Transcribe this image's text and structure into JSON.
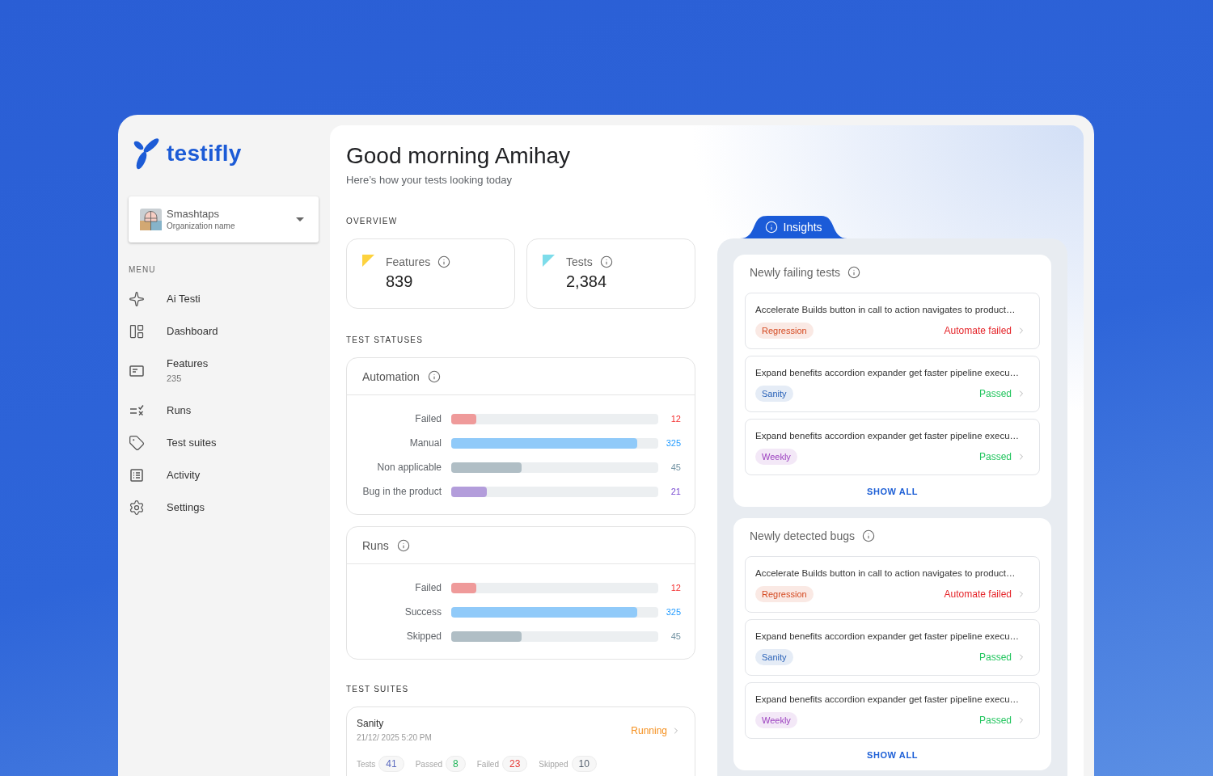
{
  "sidebar": {
    "brand": "testifly",
    "org": {
      "name": "Smashtaps",
      "subtitle": "Organization name"
    },
    "menu_heading": "MENU",
    "menu": [
      {
        "label": "Ai Testi"
      },
      {
        "label": "Dashboard"
      },
      {
        "label": "Features",
        "count": "235"
      },
      {
        "label": "Runs"
      },
      {
        "label": "Test suites"
      },
      {
        "label": "Activity"
      },
      {
        "label": "Settings"
      }
    ]
  },
  "header": {
    "title": "Good morning Amihay",
    "subtitle": "Here’s how your tests looking today"
  },
  "overview": {
    "heading": "OVERVIEW",
    "cards": [
      {
        "label": "Features",
        "value": "839",
        "color": "#fdd23e"
      },
      {
        "label": "Tests",
        "value": "2,384",
        "color": "#7ddcea"
      }
    ]
  },
  "test_statuses": {
    "heading": "TEST STATUSES",
    "panels": [
      {
        "title": "Automation",
        "rows": [
          {
            "label": "Failed",
            "value": "12",
            "level": 0.12,
            "color": "#ef9a9a"
          },
          {
            "label": "Manual",
            "value": "325",
            "level": 0.9,
            "color": "#90caf9"
          },
          {
            "label": "Non applicable",
            "value": "45",
            "level": 0.34,
            "color": "#b0bec5"
          },
          {
            "label": "Bug in the product",
            "value": "21",
            "level": 0.17,
            "color": "#b39ddb"
          }
        ]
      },
      {
        "title": "Runs",
        "rows": [
          {
            "label": "Failed",
            "value": "12",
            "level": 0.12,
            "color": "#ef9a9a"
          },
          {
            "label": "Success",
            "value": "325",
            "level": 0.9,
            "color": "#90caf9"
          },
          {
            "label": "Skipped",
            "value": "45",
            "level": 0.34,
            "color": "#b0bec5"
          }
        ]
      }
    ]
  },
  "test_suites": {
    "heading": "TEST SUITES",
    "items": [
      {
        "name": "Sanity",
        "date": "21/12/ 2025 5:20 PM",
        "status": {
          "label": "Running",
          "kind": "running"
        },
        "counts": [
          {
            "label": "Tests",
            "value": "41",
            "color": "#5c6bc0"
          },
          {
            "label": "Passed",
            "value": "8",
            "color": "#21b65a"
          },
          {
            "label": "Failed",
            "value": "23",
            "color": "#e53935"
          },
          {
            "label": "Skipped",
            "value": "10",
            "color": "#55606e"
          }
        ]
      }
    ]
  },
  "insights": {
    "tab": "Insights",
    "sections": [
      {
        "title": "Newly failing tests",
        "items": [
          {
            "text": "Accelerate Builds button in call to action navigates to product…",
            "tag": {
              "label": "Regression",
              "color": "#d4481f"
            },
            "status": {
              "label": "Automate failed",
              "kind": "failed"
            }
          },
          {
            "text": "Expand benefits accordion expander get faster pipeline execu…",
            "tag": {
              "label": "Sanity",
              "color": "#2a62b8"
            },
            "status": {
              "label": "Passed",
              "kind": "passed"
            }
          },
          {
            "text": "Expand benefits accordion expander get faster pipeline execu…",
            "tag": {
              "label": "Weekly",
              "color": "#9b3fbf"
            },
            "status": {
              "label": "Passed",
              "kind": "passed"
            }
          }
        ],
        "action": "SHOW ALL"
      },
      {
        "title": "Newly detected bugs",
        "items": [
          {
            "text": "Accelerate Builds button in call to action navigates to product…",
            "tag": {
              "label": "Regression",
              "color": "#d4481f"
            },
            "status": {
              "label": "Automate failed",
              "kind": "failed"
            }
          },
          {
            "text": "Expand benefits accordion expander get faster pipeline execu…",
            "tag": {
              "label": "Sanity",
              "color": "#2a62b8"
            },
            "status": {
              "label": "Passed",
              "kind": "passed"
            }
          },
          {
            "text": "Expand benefits accordion expander get faster pipeline execu…",
            "tag": {
              "label": "Weekly",
              "color": "#9b3fbf"
            },
            "status": {
              "label": "Passed",
              "kind": "passed"
            }
          }
        ],
        "action": "SHOW ALL"
      }
    ]
  }
}
